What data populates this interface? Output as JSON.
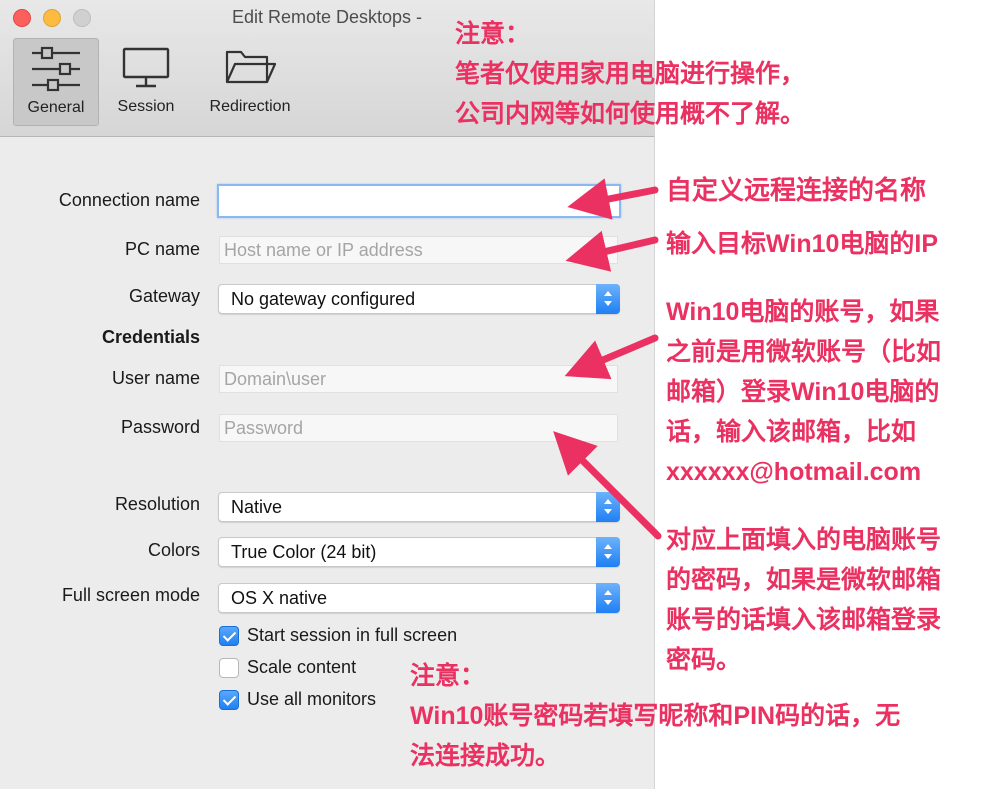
{
  "window": {
    "title": "Edit Remote Desktops -"
  },
  "tabs": [
    {
      "label": "General",
      "icon": "sliders-icon"
    },
    {
      "label": "Session",
      "icon": "monitor-icon"
    },
    {
      "label": "Redirection",
      "icon": "folder-icon"
    }
  ],
  "form": {
    "connection_name": {
      "label": "Connection name",
      "value": ""
    },
    "pc_name": {
      "label": "PC name",
      "placeholder": "Host name or IP address"
    },
    "gateway": {
      "label": "Gateway",
      "value": "No gateway configured"
    },
    "credentials_heading": "Credentials",
    "user_name": {
      "label": "User name",
      "placeholder": "Domain\\user"
    },
    "password": {
      "label": "Password",
      "placeholder": "Password"
    },
    "resolution": {
      "label": "Resolution",
      "value": "Native"
    },
    "colors": {
      "label": "Colors",
      "value": "True Color (24 bit)"
    },
    "full_screen_mode": {
      "label": "Full screen mode",
      "value": "OS X native"
    },
    "checkboxes": [
      {
        "label": "Start session in full screen",
        "checked": true
      },
      {
        "label": "Scale content",
        "checked": false
      },
      {
        "label": "Use all monitors",
        "checked": true
      }
    ]
  },
  "annotations": {
    "color": "#ea3161",
    "top_note": "注意：\n笔者仅使用家用电脑进行操作，\n公司内网等如何使用概不了解。",
    "connection_name_note": "自定义远程连接的名称",
    "pc_name_note": "输入目标Win10电脑的IP",
    "user_name_note": "Win10电脑的账号，如果\n之前是用微软账号（比如\n邮箱）登录Win10电脑的\n话，输入该邮箱，比如\nxxxxxx@hotmail.com",
    "password_note": "对应上面填入的电脑账号\n的密码，如果是微软邮箱\n账号的话填入该邮箱登录\n密码。",
    "bottom_note": "注意：\nWin10账号密码若填写昵称和PIN码的话，无\n法连接成功。"
  }
}
